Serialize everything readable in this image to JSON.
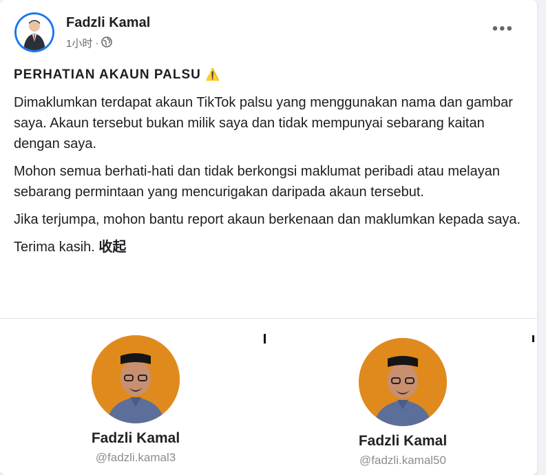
{
  "post": {
    "author": "Fadzli Kamal",
    "time": "1小时",
    "separator": "·",
    "more_label": "•••",
    "headline": "PERHATIAN AKAUN PALSU",
    "warning_emoji": "⚠️",
    "paragraphs": [
      "Dimaklumkan terdapat akaun TikTok palsu yang menggunakan nama dan gambar saya. Akaun tersebut bukan milik saya dan tidak mempunyai sebarang kaitan dengan saya.",
      "Mohon semua berhati-hati dan tidak berkongsi maklumat peribadi atau melayan sebarang permintaan yang mencurigakan daripada akaun tersebut.",
      "Jika terjumpa, mohon bantu report akaun berkenaan dan maklumkan kepada saya."
    ],
    "closing": "Terima kasih.",
    "collapse_label": "收起"
  },
  "media": {
    "profiles": [
      {
        "name": "Fadzli Kamal",
        "handle": "@fadzli.kamal3"
      },
      {
        "name": "Fadzli Kamal",
        "handle": "@fadzli.kamal50"
      }
    ]
  },
  "colors": {
    "accent": "#1877f2",
    "avatar_orange": "#e08a1e",
    "muted": "#65676b"
  },
  "icons": [
    "globe-icon",
    "warning-icon",
    "more-options-icon"
  ]
}
